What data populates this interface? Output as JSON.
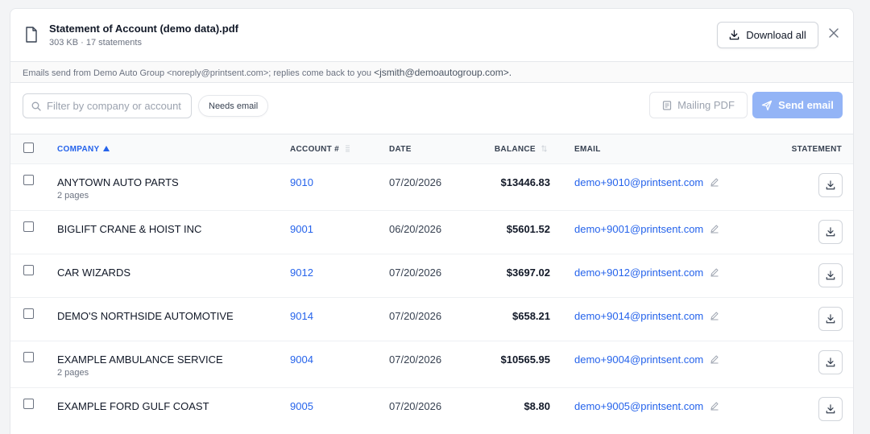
{
  "file": {
    "title": "Statement of Account (demo data).pdf",
    "meta": "303 KB · 17 statements",
    "download_all_label": "Download all",
    "close_icon": "close-icon"
  },
  "notice": {
    "text": "Emails send from Demo Auto Group <noreply@printsent.com>; replies come back to you ",
    "reply": "<jsmith@demoautogroup.com>."
  },
  "toolbar": {
    "filter_placeholder": "Filter by company or account",
    "needs_email_label": "Needs email",
    "mailing_pdf_label": "Mailing PDF",
    "send_email_label": "Send email"
  },
  "columns": {
    "company": "COMPANY",
    "account": "ACCOUNT #",
    "date": "DATE",
    "balance": "BALANCE",
    "email": "EMAIL",
    "statement": "STATEMENT"
  },
  "rows": [
    {
      "company": "ANYTOWN AUTO PARTS",
      "pages": "2 pages",
      "account": "9010",
      "date": "07/20/2026",
      "balance": "$13446.83",
      "email": "demo+9010@printsent.com"
    },
    {
      "company": "BIGLIFT CRANE & HOIST INC",
      "pages": "",
      "account": "9001",
      "date": "06/20/2026",
      "balance": "$5601.52",
      "email": "demo+9001@printsent.com"
    },
    {
      "company": "CAR WIZARDS",
      "pages": "",
      "account": "9012",
      "date": "07/20/2026",
      "balance": "$3697.02",
      "email": "demo+9012@printsent.com"
    },
    {
      "company": "DEMO'S NORTHSIDE AUTOMOTIVE",
      "pages": "",
      "account": "9014",
      "date": "07/20/2026",
      "balance": "$658.21",
      "email": "demo+9014@printsent.com"
    },
    {
      "company": "EXAMPLE AMBULANCE SERVICE",
      "pages": "2 pages",
      "account": "9004",
      "date": "07/20/2026",
      "balance": "$10565.95",
      "email": "demo+9004@printsent.com"
    },
    {
      "company": "EXAMPLE FORD GULF COAST",
      "pages": "",
      "account": "9005",
      "date": "07/20/2026",
      "balance": "$8.80",
      "email": "demo+9005@printsent.com"
    }
  ],
  "colors": {
    "accent": "#2563eb",
    "send_button": "#93b4f6"
  }
}
